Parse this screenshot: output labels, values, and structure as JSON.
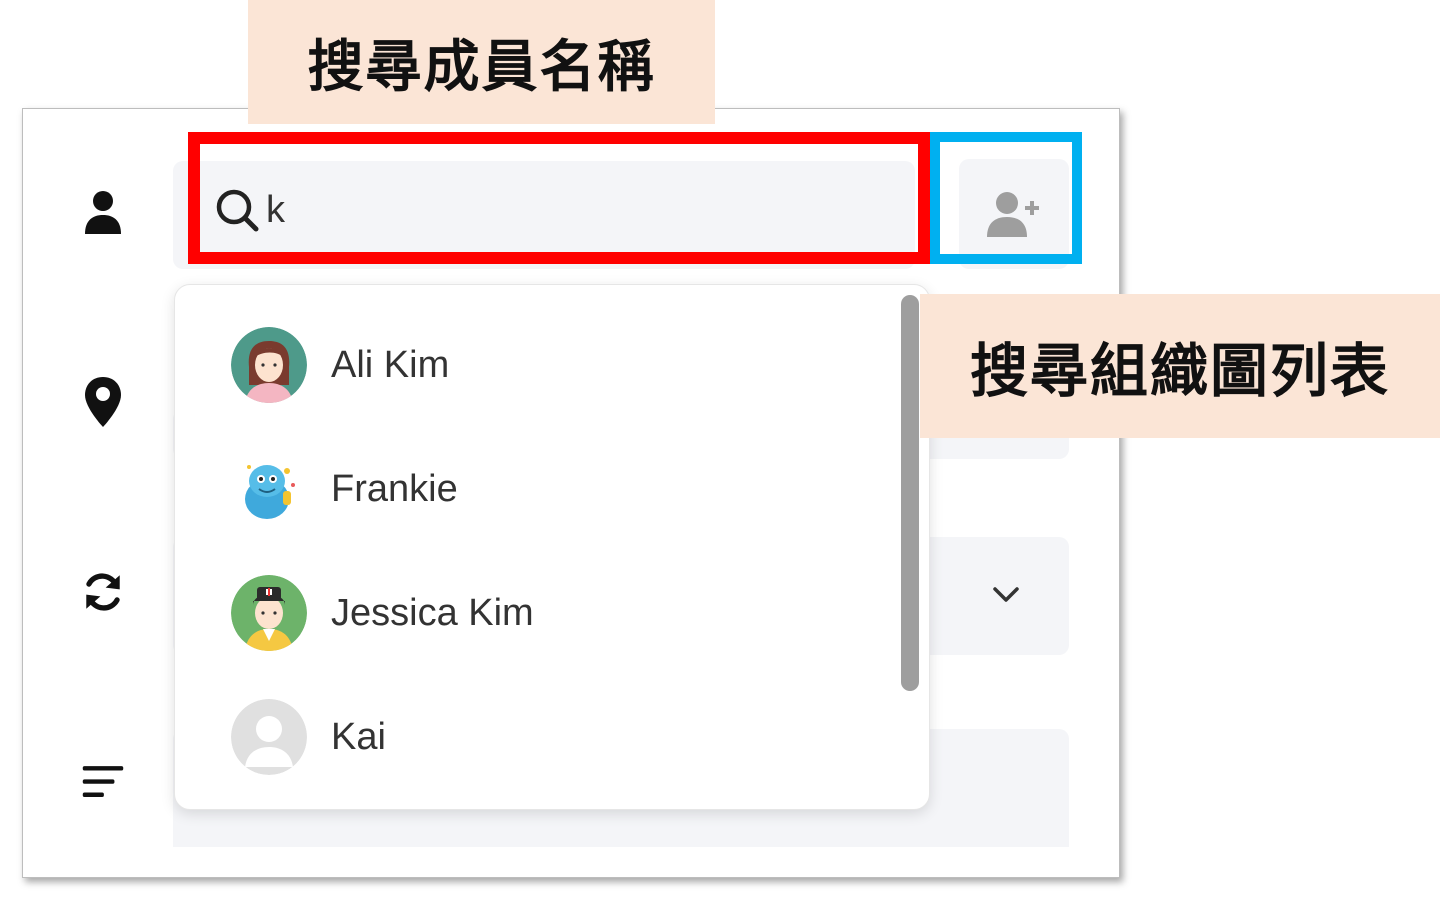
{
  "annotations": {
    "search_member_label": "搜尋成員名稱",
    "search_org_label": "搜尋組織圖列表"
  },
  "search": {
    "value": "k"
  },
  "sidebar": {
    "items": [
      {
        "icon": "person-icon"
      },
      {
        "icon": "location-pin-icon"
      },
      {
        "icon": "sync-icon"
      },
      {
        "icon": "sort-icon"
      }
    ]
  },
  "results": [
    {
      "name": "Ali Kim",
      "avatar": "woman-avatar"
    },
    {
      "name": "Frankie",
      "avatar": "blue-monster-avatar"
    },
    {
      "name": "Jessica Kim",
      "avatar": "doctor-avatar"
    },
    {
      "name": "Kai",
      "avatar": "default-avatar"
    }
  ],
  "colors": {
    "highlight_red": "#ff0000",
    "highlight_blue": "#00b0f0",
    "callout_bg": "#fbe5d6",
    "field_bg": "#f4f5f8"
  }
}
